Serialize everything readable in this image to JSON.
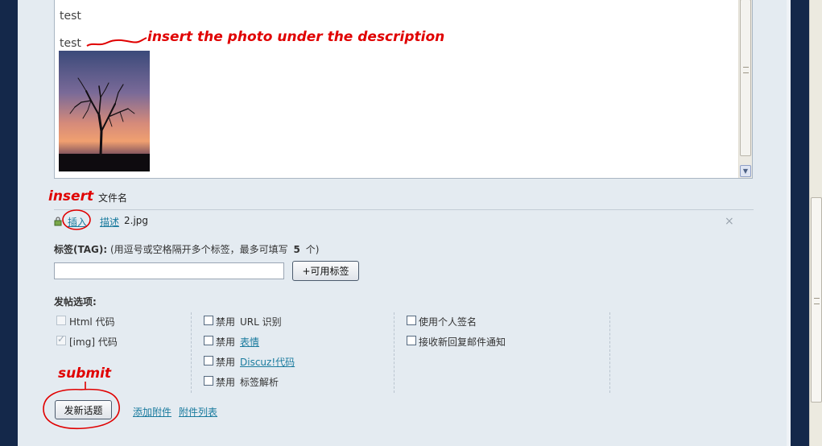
{
  "editor": {
    "line1": "test",
    "line2": "test"
  },
  "annotations": {
    "photo_note": "insert the photo under the description",
    "insert_note": "insert",
    "submit_note": "submit"
  },
  "attachments": {
    "header": "文件名",
    "insert_label": "插入",
    "describe_label": "描述",
    "filename": "2.jpg",
    "remove_symbol": "×"
  },
  "tags": {
    "label": "标签(TAG):",
    "hint_prefix": "(用逗号或空格隔开多个标签，最多可填写",
    "max_count": "5",
    "hint_suffix": "个)",
    "input_value": "",
    "available_button": "+可用标签"
  },
  "options": {
    "title": "发帖选项:",
    "col1": [
      {
        "label": "Html 代码",
        "checked": false,
        "disabled": true
      },
      {
        "label": "[img] 代码",
        "checked": true,
        "disabled": true
      }
    ],
    "col2": [
      {
        "prefix": "禁用",
        "label": "URL 识别",
        "is_link": false
      },
      {
        "prefix": "禁用",
        "label": "表情",
        "is_link": true
      },
      {
        "prefix": "禁用",
        "label": "Discuz!代码",
        "is_link": true
      },
      {
        "prefix": "禁用",
        "label": "标签解析",
        "is_link": false
      }
    ],
    "col3": [
      {
        "label": "使用个人签名"
      },
      {
        "label": "接收新回复邮件通知"
      }
    ]
  },
  "actions": {
    "submit_button": "发新话题",
    "add_attachment": "添加附件",
    "attachment_list": "附件列表"
  },
  "colors": {
    "annotation": "#e00000",
    "link": "#1a7b9e",
    "page_background": "#14284a",
    "panel_background": "#e4ebf1"
  },
  "icons": {
    "lock": "lock-icon",
    "remove": "close-icon",
    "scroll_down": "chevron-down-icon"
  }
}
